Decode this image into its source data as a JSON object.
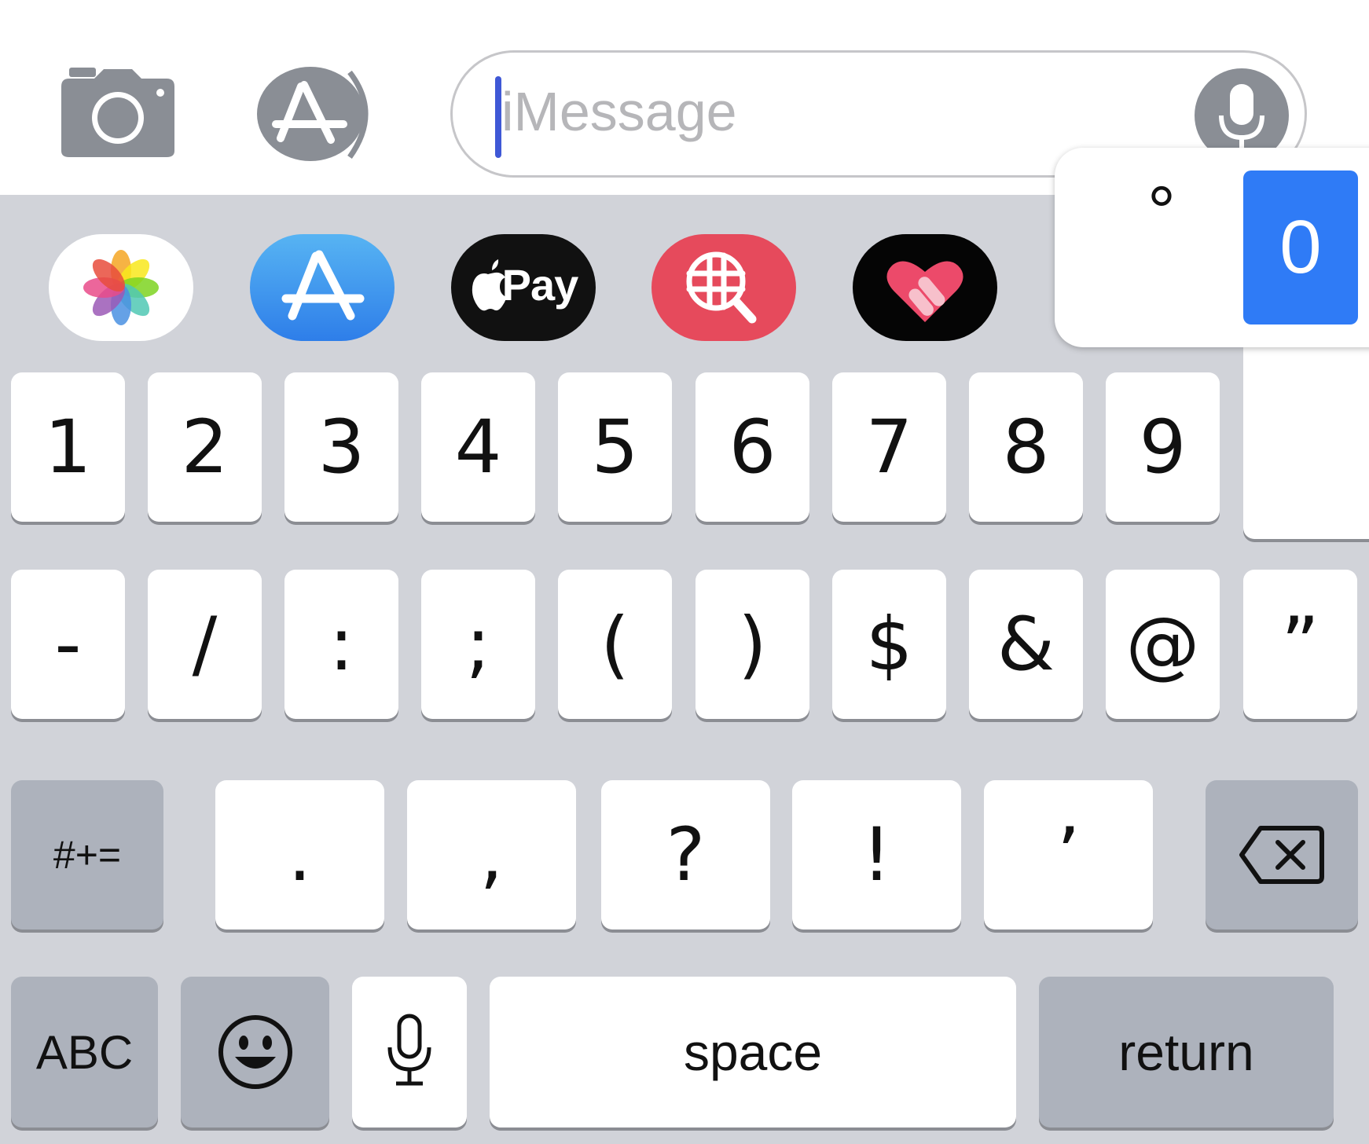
{
  "message_field": {
    "placeholder": "iMessage"
  },
  "app_drawer": {
    "apple_pay_label": "Pay"
  },
  "number_row": [
    "1",
    "2",
    "3",
    "4",
    "5",
    "6",
    "7",
    "8",
    "9"
  ],
  "symbol_row": [
    "-",
    "/",
    ":",
    ";",
    "(",
    ")",
    "$",
    "&",
    "@",
    "”"
  ],
  "punct_row": [
    ".",
    ",",
    "?",
    "!",
    "’"
  ],
  "bottom_row": {
    "abc": "ABC",
    "space": "space",
    "return": "return"
  },
  "more_symbols_label": "#+=",
  "popup": {
    "options": [
      "°",
      "0"
    ],
    "selected": "0"
  },
  "colors": {
    "accent": "#2f7bf6",
    "cursor": "#3f58d6",
    "keyboard_bg": "#d1d3d9",
    "special_key": "#adb2bc"
  }
}
